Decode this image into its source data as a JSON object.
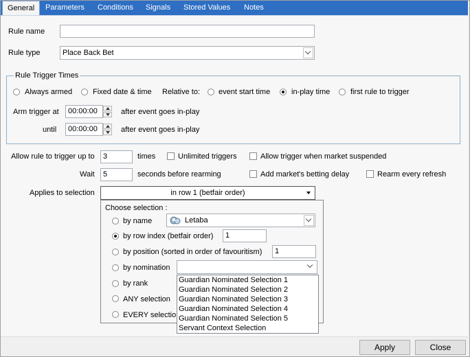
{
  "tabs": [
    "General",
    "Parameters",
    "Conditions",
    "Signals",
    "Stored Values",
    "Notes"
  ],
  "rule_name": {
    "label": "Rule name",
    "value": ""
  },
  "rule_type": {
    "label": "Rule type",
    "value": "Place Back Bet"
  },
  "trigger_times": {
    "title": "Rule Trigger Times",
    "always_armed": "Always armed",
    "fixed_date": "Fixed date & time",
    "relative_to": "Relative to:",
    "event_start": "event start time",
    "in_play": "in-play time",
    "first_rule": "first rule to trigger",
    "arm_label": "Arm trigger at",
    "arm_value": "00:00:00",
    "arm_after": "after event goes in-play",
    "until_label": "until",
    "until_value": "00:00:00",
    "until_after": "after event goes in-play"
  },
  "allow_up_to": {
    "label": "Allow rule to trigger up to",
    "value": "3",
    "suffix": "times"
  },
  "unlimited": "Unlimited triggers",
  "allow_suspended": "Allow trigger when market suspended",
  "wait": {
    "label": "Wait",
    "value": "5",
    "suffix": "seconds before rearming"
  },
  "add_delay": "Add market's betting delay",
  "rearm": "Rearm every refresh",
  "applies": {
    "label": "Applies to selection",
    "value": "in row 1 (betfair order)"
  },
  "choose": {
    "title": "Choose selection :",
    "by_name": "by name",
    "name_value": "Letaba",
    "by_row": "by row index (betfair order)",
    "row_value": "1",
    "by_position": "by position (sorted in order of favouritism)",
    "position_value": "1",
    "by_nomination": "by nomination",
    "nomination_value": "",
    "by_rank": "by rank",
    "any": "ANY selection",
    "every": "EVERY selectio"
  },
  "nomination_options": [
    "Guardian Nominated Selection 1",
    "Guardian Nominated Selection 2",
    "Guardian Nominated Selection 3",
    "Guardian Nominated Selection 4",
    "Guardian Nominated Selection 5",
    "Servant Context Selection"
  ],
  "buttons": {
    "apply": "Apply",
    "close": "Close"
  }
}
